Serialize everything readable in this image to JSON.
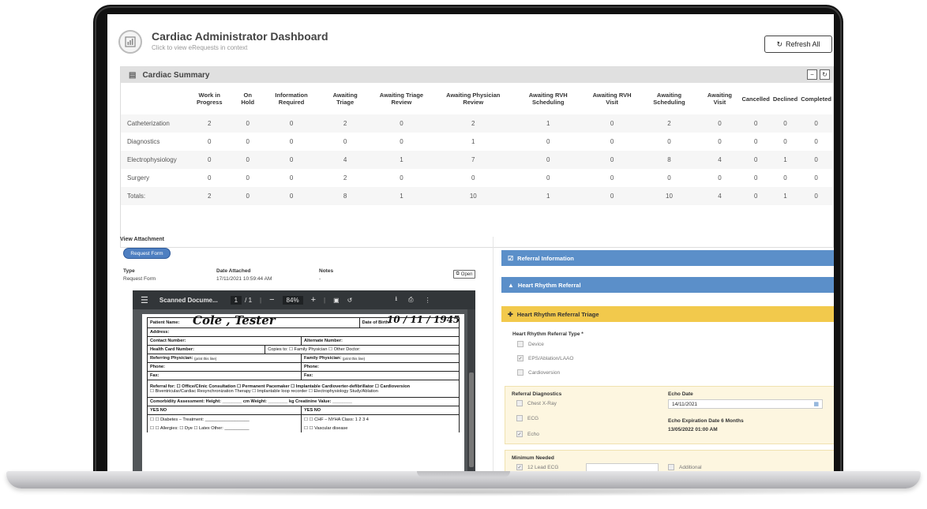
{
  "app": {
    "title": "Cardiac Administrator Dashboard",
    "subtitle": "Click to view eRequests in context",
    "refresh_label": "Refresh All"
  },
  "summary": {
    "title": "Cardiac Summary",
    "columns": [
      "Work in Progress",
      "On Hold",
      "Information Required",
      "Awaiting Triage",
      "Awaiting Triage Review",
      "Awaiting Physician Review",
      "Awaiting RVH Scheduling",
      "Awaiting RVH Visit",
      "Awaiting Scheduling",
      "Awaiting Visit",
      "Cancelled",
      "Declined",
      "Completed"
    ],
    "rows": [
      {
        "label": "Catheterization",
        "values": [
          "2",
          "0",
          "0",
          "2",
          "0",
          "2",
          "1",
          "0",
          "2",
          "0",
          "0",
          "0",
          "0"
        ]
      },
      {
        "label": "Diagnostics",
        "values": [
          "0",
          "0",
          "0",
          "0",
          "0",
          "1",
          "0",
          "0",
          "0",
          "0",
          "0",
          "0",
          "0"
        ]
      },
      {
        "label": "Electrophysiology",
        "values": [
          "0",
          "0",
          "0",
          "4",
          "1",
          "7",
          "0",
          "0",
          "8",
          "4",
          "0",
          "1",
          "0"
        ]
      },
      {
        "label": "Surgery",
        "values": [
          "0",
          "0",
          "0",
          "2",
          "0",
          "0",
          "0",
          "0",
          "0",
          "0",
          "0",
          "0",
          "0"
        ]
      },
      {
        "label": "Totals:",
        "values": [
          "2",
          "0",
          "0",
          "8",
          "1",
          "10",
          "1",
          "0",
          "10",
          "4",
          "0",
          "1",
          "0"
        ]
      }
    ]
  },
  "attachment": {
    "section_label": "View Attachment",
    "pill_label": "Request Form",
    "headers": {
      "type": "Type",
      "date": "Date Attached",
      "notes": "Notes"
    },
    "row": {
      "type": "Request Form",
      "date": "17/11/2021 10:59:44 AM",
      "notes": "-"
    },
    "open_label": "Open"
  },
  "pdf": {
    "title": "Scanned Docume...",
    "page_current": "1",
    "page_total": "/ 1",
    "zoom": "84%",
    "form": {
      "patient_name_label": "Patient Name:",
      "patient_name_value": "Cole , Tester",
      "dob_label": "Date of Birth:",
      "dob_value": "10 / 11 / 1945",
      "address_label": "Address:",
      "contact_label": "Contact Number:",
      "alternate_label": "Alternate Number:",
      "health_card_label": "Health Card Number:",
      "copies_label": "Copies to: ☐ Family Physician ☐ Other Doctor:",
      "referring_label": "Referring Physician:",
      "family_label": "Family Physician:",
      "print_hint": "(print this line)",
      "phone_label": "Phone:",
      "fax_label": "Fax:",
      "referral_line1": "Referral for: ☐ Office/Clinic Consultation ☐ Permanent Pacemaker ☐ Implantable Cardioverter-defibrillator ☐ Cardioversion",
      "referral_line2": "☐ Biventricular/Cardiac Resynchronization Therapy ☐ Implantable loop recorder ☐ Electrophysiology Study/Ablation",
      "comorbidity": "Comorbidity Assessment: Height: ________ cm  Weight: ________ kg  Creatinine Value: ________",
      "yes_no": "YES  NO",
      "diabetes": "☐  ☐  Diabetes – Treatment: __________________",
      "chf": "☐  ☐  CHF – NYHA Class: 1  2  3  4",
      "allergies": "☐  ☐  Allergies: ☐ Dye  ☐ Latex  Other: __________",
      "vascular": "☐  ☐  Vascular disease"
    }
  },
  "referral": {
    "info_label": "Referral Information",
    "heart_rhythm_label": "Heart Rhythm Referral",
    "triage_label": "Heart Rhythm Referral Triage",
    "type_label": "Heart Rhythm Referral Type *",
    "types": [
      {
        "label": "Device",
        "checked": false
      },
      {
        "label": "EPS/Ablation/LAAO",
        "checked": true
      },
      {
        "label": "Cardioversion",
        "checked": false
      }
    ],
    "diagnostics_label": "Referral Diagnostics",
    "diagnostics": [
      {
        "label": "Chest X-Ray",
        "checked": false
      },
      {
        "label": "ECG",
        "checked": false
      },
      {
        "label": "Echo",
        "checked": true
      }
    ],
    "echo_date_label": "Echo Date",
    "echo_date_value": "14/11/2021",
    "echo_exp_label": "Echo Expiration Date 6 Months",
    "echo_exp_value": "13/05/2022 01:00 AM",
    "minimum_label": "Minimum Needed",
    "min_ecg_label": "12 Lead ECG",
    "min_additional_label": "Additional Documentation"
  }
}
